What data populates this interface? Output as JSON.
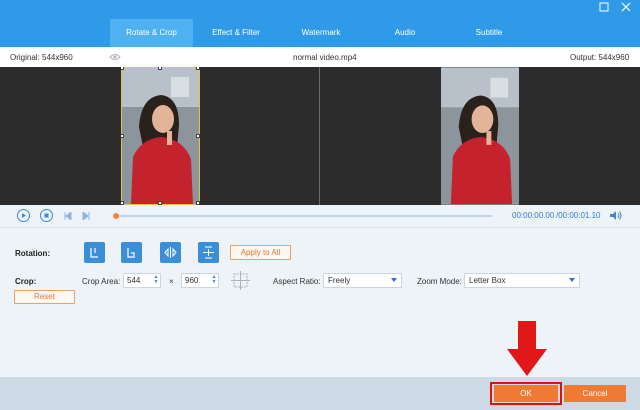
{
  "tabs": [
    {
      "label": "Rotate & Crop",
      "active": true
    },
    {
      "label": "Effect & Filter",
      "active": false
    },
    {
      "label": "Watermark",
      "active": false
    },
    {
      "label": "Audio",
      "active": false
    },
    {
      "label": "Subtitle",
      "active": false
    }
  ],
  "window": {
    "restore_icon": "restore-icon",
    "close_icon": "close-icon"
  },
  "info": {
    "original": "Original: 544x960",
    "filename": "normal video.mp4",
    "output": "Output: 544x960"
  },
  "playback": {
    "current_time": "00:00:00.00",
    "total_time": "/00:00:01.10"
  },
  "rotation": {
    "label": "Rotation:",
    "apply_all": "Apply to All"
  },
  "crop": {
    "label": "Crop:",
    "area_label": "Crop Area:",
    "width": "544",
    "times": "×",
    "height": "960",
    "aspect_label": "Aspect Ratio:",
    "aspect_value": "Freely",
    "zoom_label": "Zoom Mode:",
    "zoom_value": "Letter Box",
    "reset": "Reset"
  },
  "footer": {
    "ok": "OK",
    "cancel": "Cancel"
  },
  "colors": {
    "accent_blue": "#2f9ae8",
    "orange": "#f07a34",
    "highlight_red": "#e01010"
  }
}
